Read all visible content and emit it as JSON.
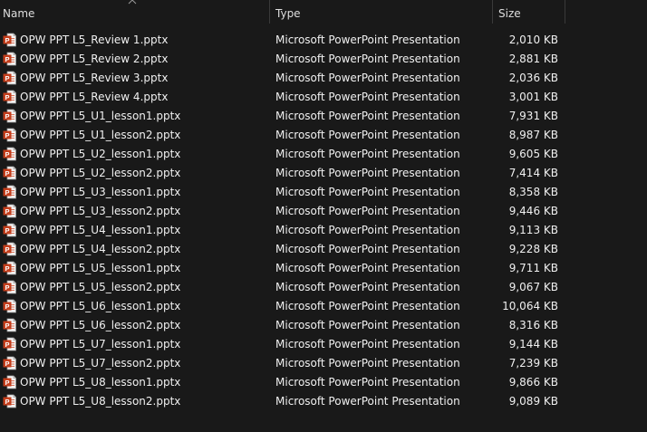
{
  "columns": {
    "name": "Name",
    "type": "Type",
    "size": "Size"
  },
  "sort": {
    "column": "Name",
    "direction": "ascending",
    "icon": "chevron-up-icon"
  },
  "file_icon": "powerpoint-file-icon",
  "files": [
    {
      "name": "OPW PPT L5_Review 1.pptx",
      "type": "Microsoft PowerPoint Presentation",
      "size": "2,010 KB"
    },
    {
      "name": "OPW PPT L5_Review 2.pptx",
      "type": "Microsoft PowerPoint Presentation",
      "size": "2,881 KB"
    },
    {
      "name": "OPW PPT L5_Review 3.pptx",
      "type": "Microsoft PowerPoint Presentation",
      "size": "2,036 KB"
    },
    {
      "name": "OPW PPT L5_Review 4.pptx",
      "type": "Microsoft PowerPoint Presentation",
      "size": "3,001 KB"
    },
    {
      "name": "OPW PPT L5_U1_lesson1.pptx",
      "type": "Microsoft PowerPoint Presentation",
      "size": "7,931 KB"
    },
    {
      "name": "OPW PPT L5_U1_lesson2.pptx",
      "type": "Microsoft PowerPoint Presentation",
      "size": "8,987 KB"
    },
    {
      "name": "OPW PPT L5_U2_lesson1.pptx",
      "type": "Microsoft PowerPoint Presentation",
      "size": "9,605 KB"
    },
    {
      "name": "OPW PPT L5_U2_lesson2.pptx",
      "type": "Microsoft PowerPoint Presentation",
      "size": "7,414 KB"
    },
    {
      "name": "OPW PPT L5_U3_lesson1.pptx",
      "type": "Microsoft PowerPoint Presentation",
      "size": "8,358 KB"
    },
    {
      "name": "OPW PPT L5_U3_lesson2.pptx",
      "type": "Microsoft PowerPoint Presentation",
      "size": "9,446 KB"
    },
    {
      "name": "OPW PPT L5_U4_lesson1.pptx",
      "type": "Microsoft PowerPoint Presentation",
      "size": "9,113 KB"
    },
    {
      "name": "OPW PPT L5_U4_lesson2.pptx",
      "type": "Microsoft PowerPoint Presentation",
      "size": "9,228 KB"
    },
    {
      "name": "OPW PPT L5_U5_lesson1.pptx",
      "type": "Microsoft PowerPoint Presentation",
      "size": "9,711 KB"
    },
    {
      "name": "OPW PPT L5_U5_lesson2.pptx",
      "type": "Microsoft PowerPoint Presentation",
      "size": "9,067 KB"
    },
    {
      "name": "OPW PPT L5_U6_lesson1.pptx",
      "type": "Microsoft PowerPoint Presentation",
      "size": "10,064 KB"
    },
    {
      "name": "OPW PPT L5_U6_lesson2.pptx",
      "type": "Microsoft PowerPoint Presentation",
      "size": "8,316 KB"
    },
    {
      "name": "OPW PPT L5_U7_lesson1.pptx",
      "type": "Microsoft PowerPoint Presentation",
      "size": "9,144 KB"
    },
    {
      "name": "OPW PPT L5_U7_lesson2.pptx",
      "type": "Microsoft PowerPoint Presentation",
      "size": "7,239 KB"
    },
    {
      "name": "OPW PPT L5_U8_lesson1.pptx",
      "type": "Microsoft PowerPoint Presentation",
      "size": "9,866 KB"
    },
    {
      "name": "OPW PPT L5_U8_lesson2.pptx",
      "type": "Microsoft PowerPoint Presentation",
      "size": "9,089 KB"
    }
  ],
  "colors": {
    "background": "#191919",
    "text": "#f0f0f0",
    "header_text": "#dedede",
    "separator": "#3a3a3a",
    "icon_orange": "#c43e1c"
  }
}
